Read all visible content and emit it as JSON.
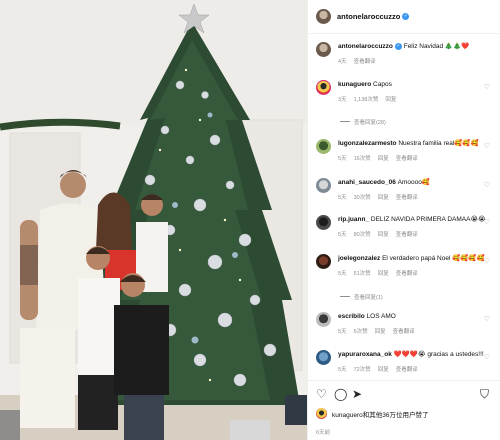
{
  "post": {
    "author": "antonelaroccuzzo",
    "caption_author": "antonelaroccuzzo",
    "caption_text": "Feliz Navidad",
    "caption_emoji": "🎄🎄❤️",
    "caption_time": "4天",
    "caption_translate": "查看翻译"
  },
  "comments": [
    {
      "user": "kunaguero",
      "text": "Capos",
      "time": "3天",
      "likes": "1,138次赞",
      "reply": "回复",
      "translate": "",
      "replies": "查看回复(28)"
    },
    {
      "user": "lugonzalezarmesto",
      "text": "Nuestra familia real🥰🥰🥰",
      "time": "5天",
      "likes": "16次赞",
      "reply": "回复",
      "translate": "查看翻译",
      "replies": ""
    },
    {
      "user": "anahi_saucedo_06",
      "text": "Amoooo🥰",
      "time": "5天",
      "likes": "30次赞",
      "reply": "回复",
      "translate": "查看翻译",
      "replies": ""
    },
    {
      "user": "rip.juann_",
      "text": "DELIZ NAVIDA PRIMERA DAMAA😭😭",
      "time": "5天",
      "likes": "80次赞",
      "reply": "回复",
      "translate": "查看翻译",
      "replies": ""
    },
    {
      "user": "joelegonzalez",
      "text": "El verdadero papá Noel 🥰🥰🥰🥰",
      "time": "5天",
      "likes": "51次赞",
      "reply": "回复",
      "translate": "查看翻译",
      "replies": "查看回复(1)"
    },
    {
      "user": "escribilo",
      "text": "LOS AMO",
      "time": "5天",
      "likes": "6次赞",
      "reply": "回复",
      "translate": "查看翻译",
      "replies": ""
    },
    {
      "user": "yapuraroxana_ok",
      "text": "❤️❤️❤️😭 gracias a ustedes!!!",
      "time": "5天",
      "likes": "72次赞",
      "reply": "回复",
      "translate": "查看翻译",
      "replies": ""
    }
  ],
  "likes_text": "kunaguero和其他36万位用户赞了",
  "post_time": "6天前",
  "colors": {
    "verified": "#3897f0",
    "meta": "#8e8e8e",
    "border": "#efefef"
  },
  "icons": [
    "heart-icon",
    "comment-icon",
    "share-icon",
    "bookmark-icon",
    "verified-badge-icon"
  ]
}
